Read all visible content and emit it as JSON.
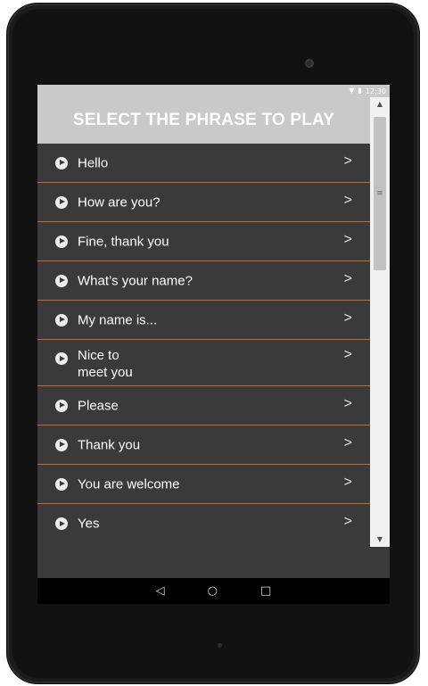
{
  "status_bar": {
    "time": "12:30",
    "icons": [
      "wifi-icon",
      "battery-icon"
    ]
  },
  "header": {
    "title": "SELECT THE PHRASE TO PLAY"
  },
  "phrases": [
    "Hello",
    "How are you?",
    "Fine, thank you",
    "What’s your name?",
    "My name is...",
    "  Nice to\nmeet you",
    "Please",
    "Thank you",
    "You are welcome",
    "Yes"
  ],
  "icons": {
    "item_leading": "play-circle-icon",
    "item_trailing": "chevron-right-icon"
  },
  "nav_bar": {
    "back": "back-icon",
    "home": "home-icon",
    "recents": "recents-icon"
  },
  "colors": {
    "header_bg": "#c9c9c9",
    "list_bg": "#3a3a3a",
    "divider": "#c46a2a",
    "text": "#ffffff"
  }
}
